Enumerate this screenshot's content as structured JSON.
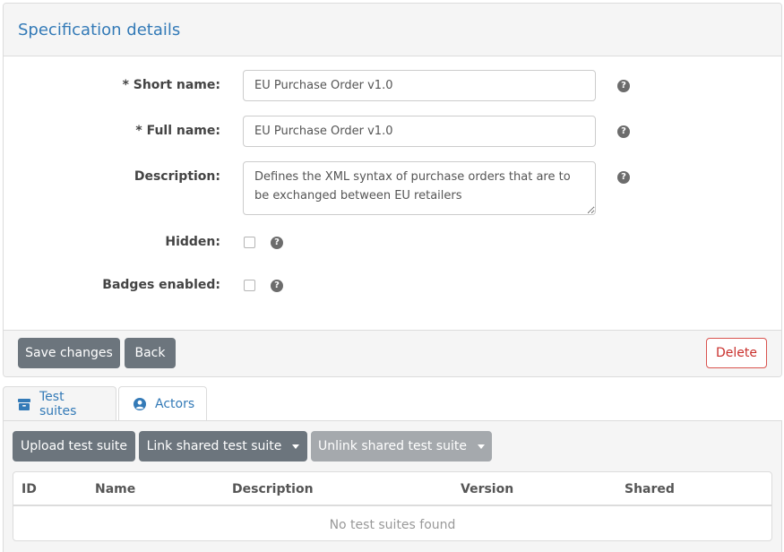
{
  "spec": {
    "title": "Specification details",
    "fields": {
      "short_name": {
        "label": "* Short name:",
        "value": "EU Purchase Order v1.0"
      },
      "full_name": {
        "label": "* Full name:",
        "value": "EU Purchase Order v1.0"
      },
      "description": {
        "label": "Description:",
        "value": "Defines the XML syntax of purchase orders that are to be exchanged between EU retailers"
      },
      "hidden": {
        "label": "Hidden:"
      },
      "badges": {
        "label": "Badges enabled:"
      }
    },
    "help_glyph": "?",
    "buttons": {
      "save": "Save changes",
      "back": "Back",
      "delete": "Delete"
    }
  },
  "tabs": [
    {
      "label": "Test suites",
      "icon": "archive-icon"
    },
    {
      "label": "Actors",
      "icon": "user-circle-icon"
    }
  ],
  "test_suites": {
    "buttons": {
      "upload": "Upload test suite",
      "link": "Link shared test suite",
      "unlink": "Unlink shared test suite"
    },
    "columns": [
      "ID",
      "Name",
      "Description",
      "Version",
      "Shared"
    ],
    "empty_message": "No test suites found"
  },
  "colors": {
    "accent": "#337ab7",
    "button_dark": "#6c757d",
    "danger": "#d9534f",
    "panel_bg": "#f5f5f5"
  }
}
